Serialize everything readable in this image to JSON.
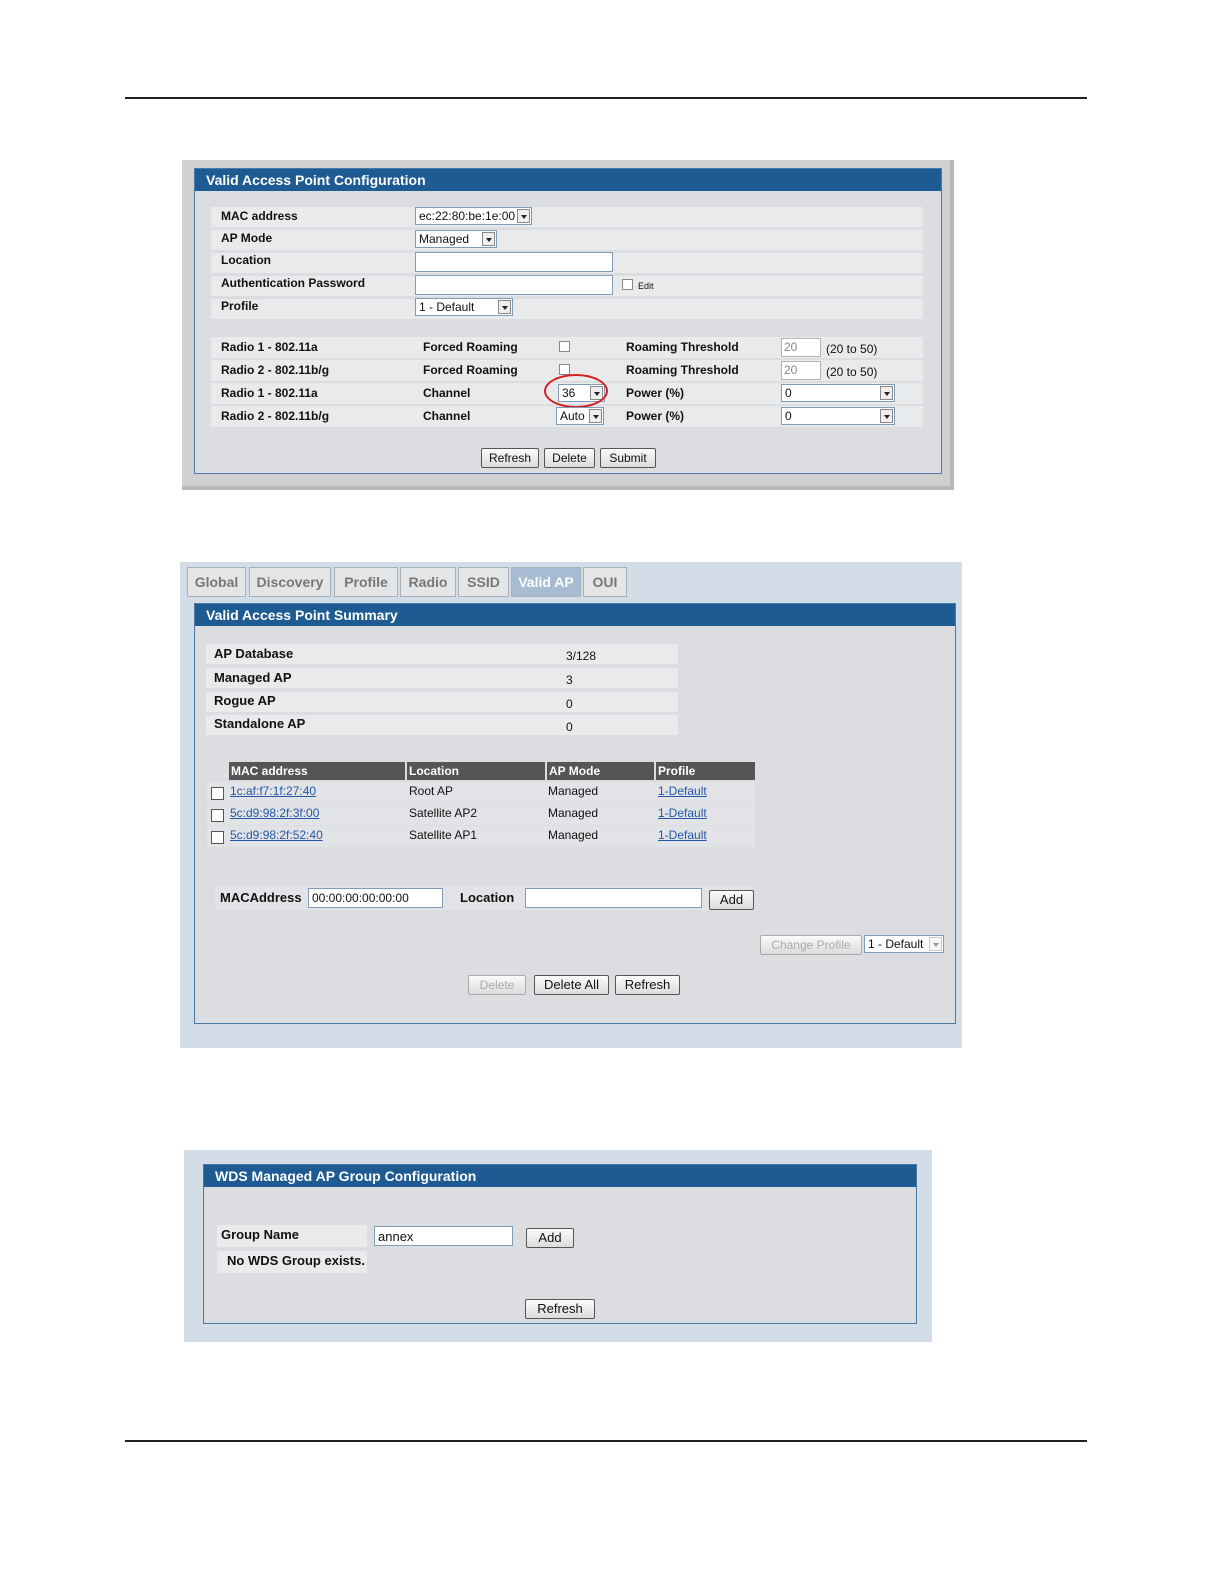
{
  "config": {
    "title": "Valid Access Point Configuration",
    "fields": {
      "mac_label": "MAC address",
      "mac_value": "ec:22:80:be:1e:00",
      "mode_label": "AP Mode",
      "mode_value": "Managed",
      "location_label": "Location",
      "location_value": "",
      "auth_label": "Authentication Password",
      "auth_value": "",
      "edit_label": "Edit",
      "profile_label": "Profile",
      "profile_value": "1 - Default"
    },
    "radios": [
      {
        "radio": "Radio 1 - 802.11a",
        "setting": "Forced Roaming",
        "param": "Roaming Threshold",
        "value": "20",
        "range": "(20 to 50)"
      },
      {
        "radio": "Radio 2 - 802.11b/g",
        "setting": "Forced Roaming",
        "param": "Roaming Threshold",
        "value": "20",
        "range": "(20 to 50)"
      },
      {
        "radio": "Radio 1 - 802.11a",
        "setting": "Channel",
        "setting_value": "36",
        "param": "Power (%)",
        "value": "0"
      },
      {
        "radio": "Radio 2 - 802.11b/g",
        "setting": "Channel",
        "setting_value": "Auto",
        "param": "Power (%)",
        "value": "0"
      }
    ],
    "buttons": {
      "refresh": "Refresh",
      "delete": "Delete",
      "submit": "Submit"
    }
  },
  "summary": {
    "tabs": [
      "Global",
      "Discovery",
      "Profile",
      "Radio",
      "SSID",
      "Valid AP",
      "OUI"
    ],
    "active_tab": "Valid AP",
    "title": "Valid Access Point Summary",
    "stats": [
      {
        "label": "AP Database",
        "value": "3/128"
      },
      {
        "label": "Managed AP",
        "value": "3"
      },
      {
        "label": "Rogue AP",
        "value": "0"
      },
      {
        "label": "Standalone AP",
        "value": "0"
      }
    ],
    "table": {
      "headers": [
        "MAC address",
        "Location",
        "AP Mode",
        "Profile"
      ],
      "rows": [
        {
          "mac": "1c:af:f7:1f:27:40",
          "location": "Root AP",
          "mode": "Managed",
          "profile": "1-Default"
        },
        {
          "mac": "5c:d9:98:2f:3f:00",
          "location": "Satellite AP2",
          "mode": "Managed",
          "profile": "1-Default"
        },
        {
          "mac": "5c:d9:98:2f:52:40",
          "location": "Satellite AP1",
          "mode": "Managed",
          "profile": "1-Default"
        }
      ]
    },
    "add_form": {
      "mac_label": "MACAddress",
      "mac_value": "00:00:00:00:00:00",
      "location_label": "Location",
      "location_value": "",
      "add_label": "Add"
    },
    "change_profile_label": "Change Profile",
    "change_profile_value": "1 - Default",
    "buttons": {
      "delete": "Delete",
      "delete_all": "Delete All",
      "refresh": "Refresh"
    }
  },
  "wds": {
    "title": "WDS Managed AP Group Configuration",
    "group_label": "Group Name",
    "group_value": "annex",
    "add_label": "Add",
    "empty_message": "No WDS Group exists.",
    "refresh_label": "Refresh"
  },
  "colors": {
    "title_bar": "#1d5b92",
    "panel_bg": "#dcdde0",
    "highlight_circle": "#d42020"
  }
}
